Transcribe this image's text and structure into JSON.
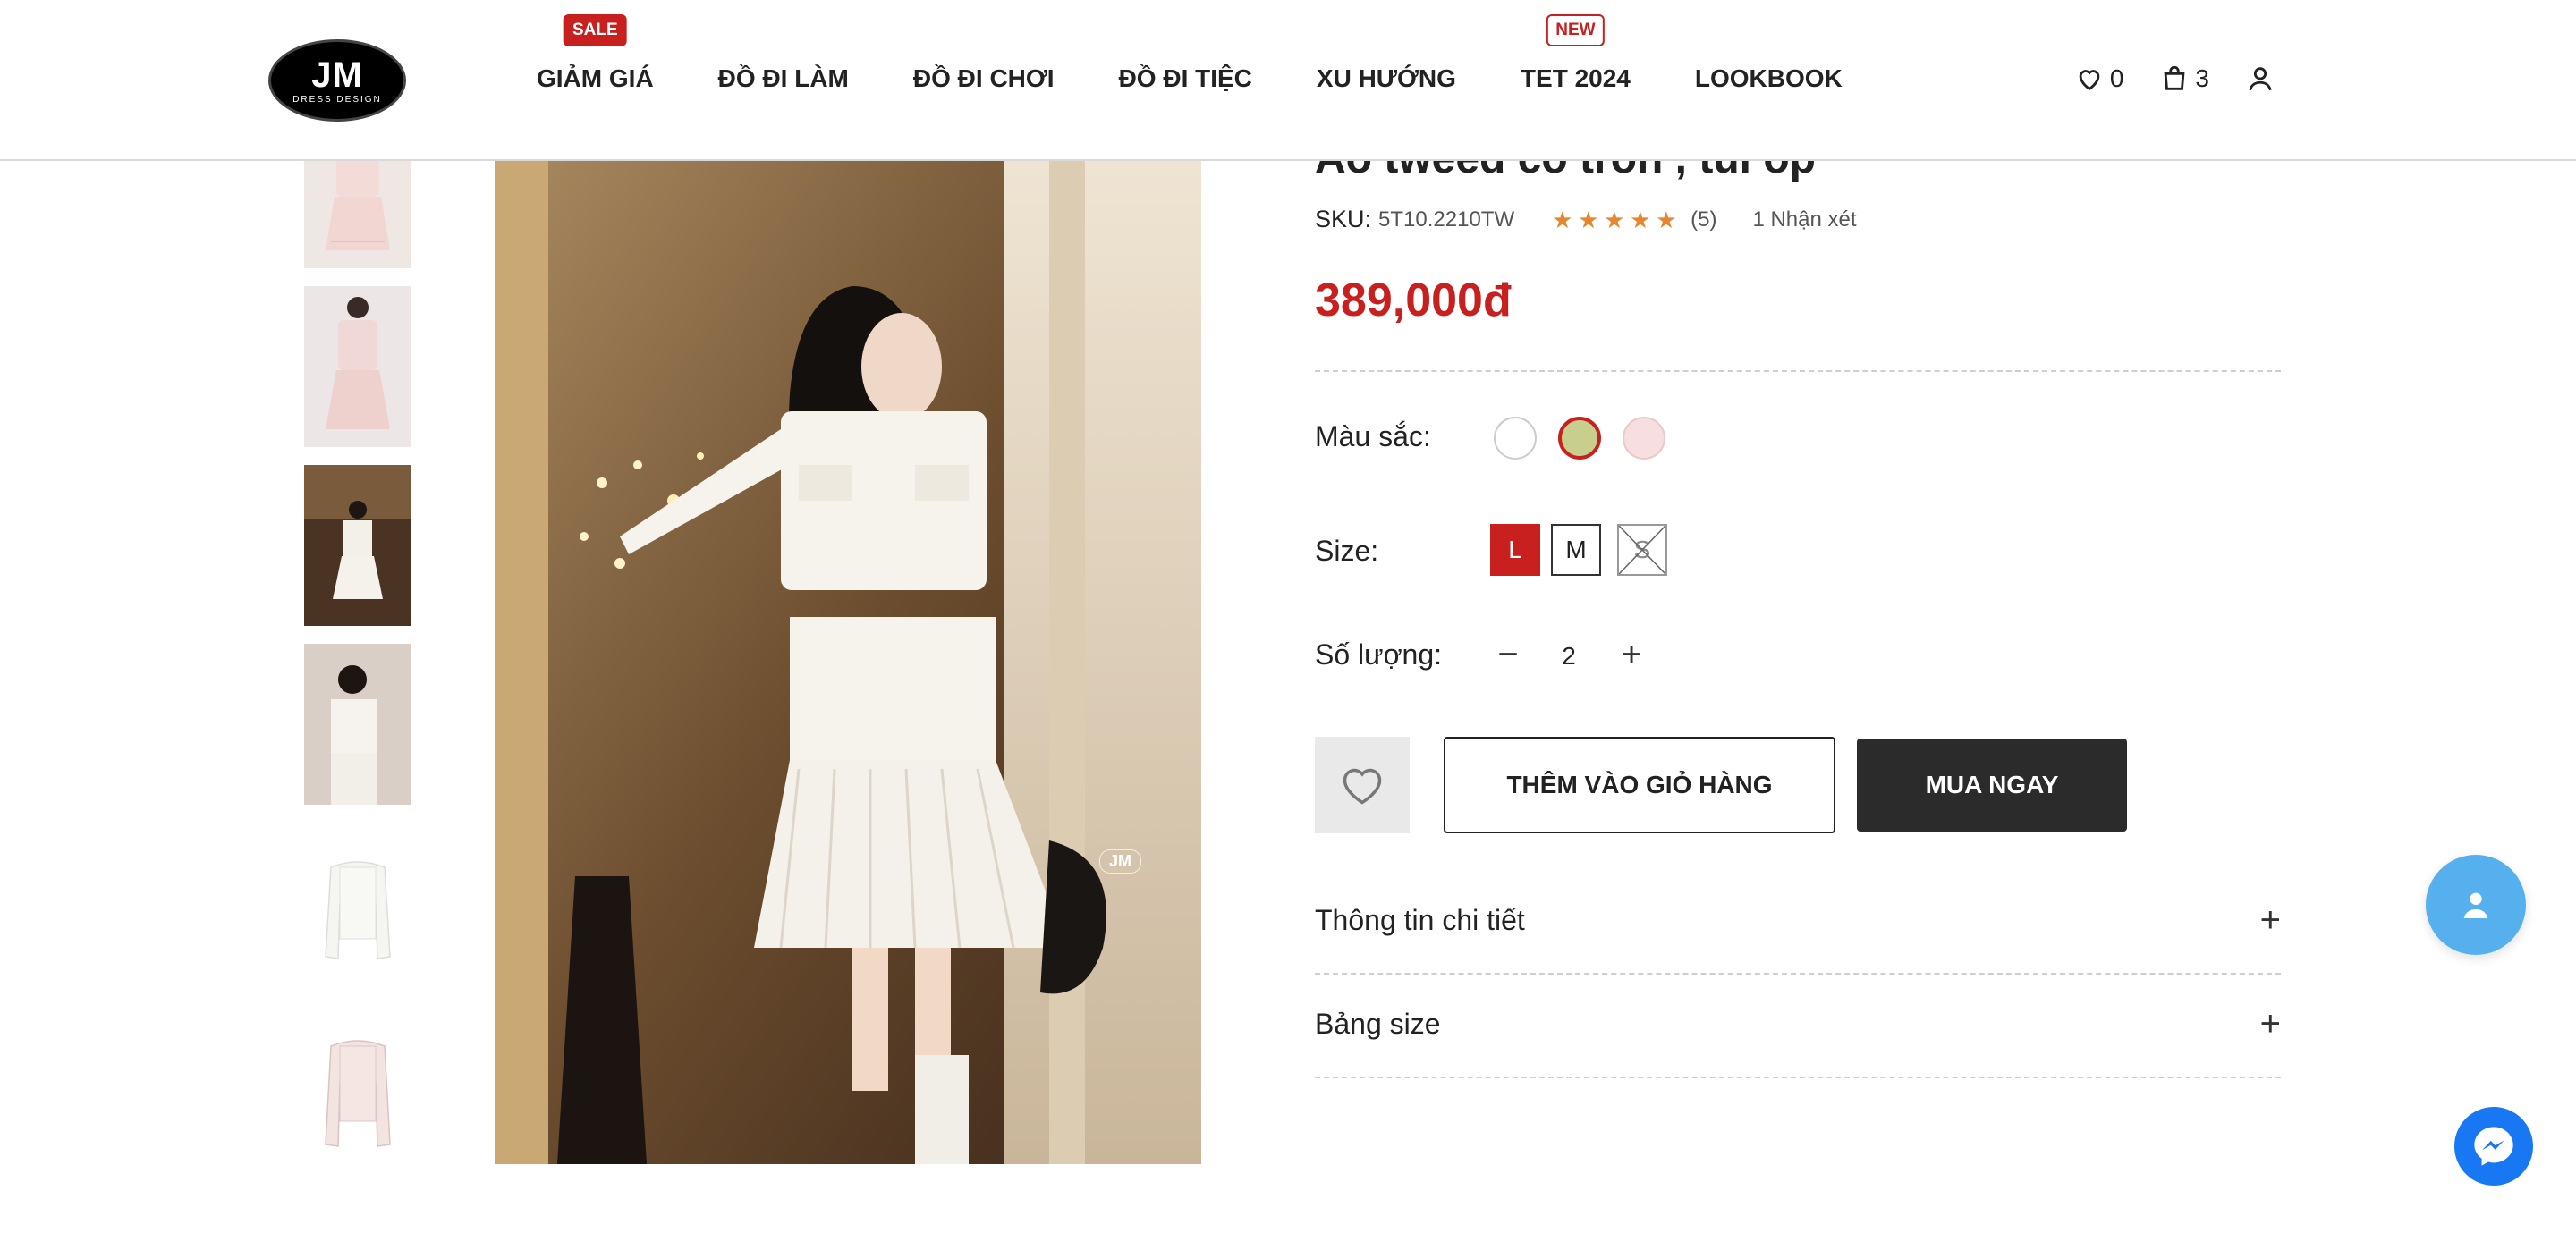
{
  "brand": {
    "logo_text": "JM",
    "logo_sub": "DRESS DESIGN"
  },
  "nav": {
    "items": [
      {
        "label": "GIẢM GIÁ",
        "badge": "SALE"
      },
      {
        "label": "ĐỒ ĐI LÀM"
      },
      {
        "label": "ĐỒ ĐI CHƠI"
      },
      {
        "label": "ĐỒ ĐI TIỆC"
      },
      {
        "label": "XU HƯỚNG"
      },
      {
        "label": "TET 2024",
        "badge": "NEW"
      },
      {
        "label": "LOOKBOOK"
      }
    ]
  },
  "header_icons": {
    "wishlist_count": "0",
    "cart_count": "3"
  },
  "product": {
    "title": "Áo tweed cổ tròn , túi ốp",
    "sku_label": "SKU:",
    "sku": "5T10.2210TW",
    "rating": 5,
    "rating_count": "(5)",
    "reviews": "1 Nhận xét",
    "price": "389,000đ"
  },
  "options": {
    "color_label": "Màu sắc:",
    "colors": [
      {
        "name": "white",
        "hex": "#ffffff",
        "selected": false
      },
      {
        "name": "olive",
        "hex": "#c8cf8c",
        "selected": true
      },
      {
        "name": "pink",
        "hex": "#f7dee0",
        "selected": false
      }
    ],
    "size_label": "Size:",
    "sizes": [
      {
        "label": "L",
        "state": "active"
      },
      {
        "label": "M",
        "state": "normal"
      },
      {
        "label": "S",
        "state": "disabled"
      }
    ],
    "qty_label": "Số lượng:",
    "qty": "2",
    "minus": "−",
    "plus": "+"
  },
  "actions": {
    "add_to_cart": "THÊM VÀO GIỎ HÀNG",
    "buy_now": "MUA NGAY"
  },
  "accordion": [
    {
      "label": "Thông tin chi tiết",
      "toggle": "+"
    },
    {
      "label": "Bảng size",
      "toggle": "+"
    }
  ],
  "watermark": "JM",
  "colors": {
    "accent": "#c8201f",
    "star": "#e8862e",
    "dark_button": "#2b2b2b",
    "contact_blue": "#56b0ee",
    "messenger_blue": "#1877f2"
  }
}
